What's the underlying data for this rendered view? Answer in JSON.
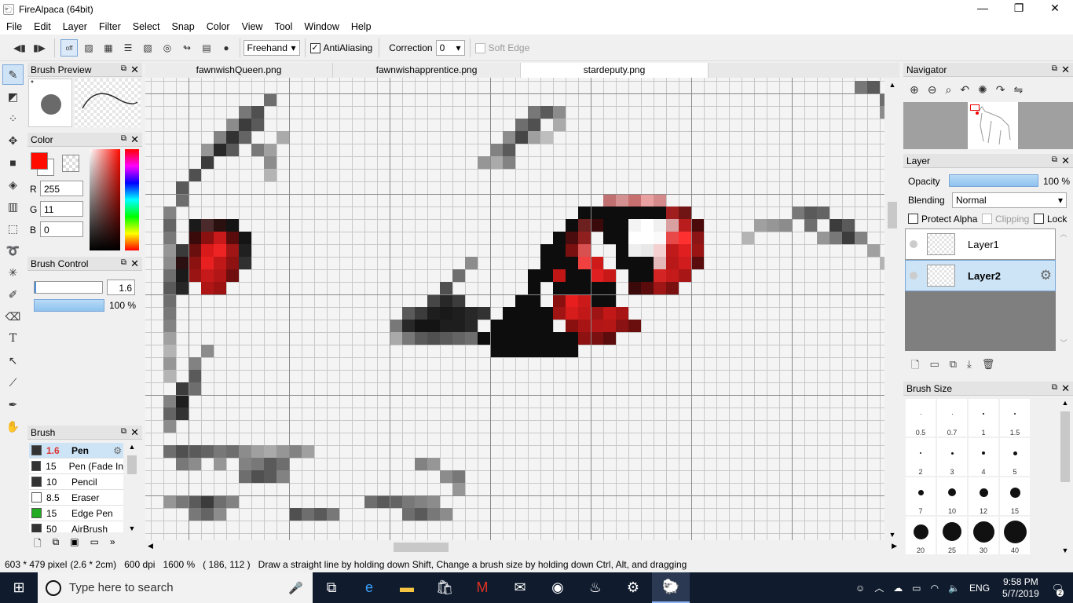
{
  "window": {
    "title": "FireAlpaca (64bit)",
    "controls": [
      "minimize",
      "restore",
      "close"
    ]
  },
  "menu": [
    "File",
    "Edit",
    "Layer",
    "Filter",
    "Select",
    "Snap",
    "Color",
    "View",
    "Tool",
    "Window",
    "Help"
  ],
  "toolbar": {
    "snap_off_label": "off",
    "stroke_mode": "Freehand",
    "antialiasing": {
      "label": "AntiAliasing",
      "checked": true
    },
    "correction": {
      "label": "Correction",
      "value": "0"
    },
    "soft_edge": {
      "label": "Soft Edge",
      "checked": false,
      "disabled": true
    }
  },
  "brush_preview": {
    "title": "Brush Preview",
    "star": "*"
  },
  "color_panel": {
    "title": "Color",
    "primary": "#ff0b00",
    "r_label": "R",
    "r": "255",
    "g_label": "G",
    "g": "11",
    "b_label": "B",
    "b": "0"
  },
  "brush_control": {
    "title": "Brush Control",
    "size": "1.6",
    "opacity": "100 %",
    "opacity_fraction": 1.0
  },
  "brush_panel": {
    "title": "Brush",
    "items": [
      {
        "size": "1.6",
        "name": "Pen",
        "color": "#333333",
        "selected": true
      },
      {
        "size": "15",
        "name": "Pen (Fade In",
        "color": "#333333"
      },
      {
        "size": "10",
        "name": "Pencil",
        "color": "#333333"
      },
      {
        "size": "8.5",
        "name": "Eraser",
        "color": "#ffffff"
      },
      {
        "size": "15",
        "name": "Edge Pen",
        "color": "#22aa22"
      },
      {
        "size": "50",
        "name": "AirBrush",
        "color": "#333333"
      }
    ]
  },
  "tabs": [
    {
      "label": "fawnwishQueen.png",
      "active": false
    },
    {
      "label": "fawnwishapprentice.png",
      "active": false
    },
    {
      "label": "stardeputy.png",
      "active": true
    }
  ],
  "navigator": {
    "title": "Navigator"
  },
  "layer_panel": {
    "title": "Layer",
    "opacity_label": "Opacity",
    "opacity": "100 %",
    "opacity_fraction": 1.0,
    "blending_label": "Blending",
    "blending": "Normal",
    "protect_alpha": "Protect Alpha",
    "clipping": "Clipping",
    "lock": "Lock",
    "layers": [
      {
        "name": "Layer1",
        "selected": false
      },
      {
        "name": "Layer2",
        "selected": true
      }
    ]
  },
  "brush_size": {
    "title": "Brush Size",
    "sizes": [
      "0.5",
      "0.7",
      "1",
      "1.5",
      "2",
      "3",
      "4",
      "5",
      "7",
      "10",
      "12",
      "15",
      "20",
      "25",
      "30",
      "40"
    ]
  },
  "status": {
    "dimensions": "603 * 479 pixel",
    "physical": "(2.6 * 2cm)",
    "dpi": "600 dpi",
    "zoom": "1600 %",
    "cursor": "( 186, 112 )",
    "hint": "Draw a straight line by holding down Shift, Change a brush size by holding down Ctrl, Alt, and dragging"
  },
  "taskbar": {
    "search_placeholder": "Type here to search",
    "language": "ENG",
    "time": "9:58 PM",
    "date": "5/7/2019",
    "notifications": "2"
  }
}
